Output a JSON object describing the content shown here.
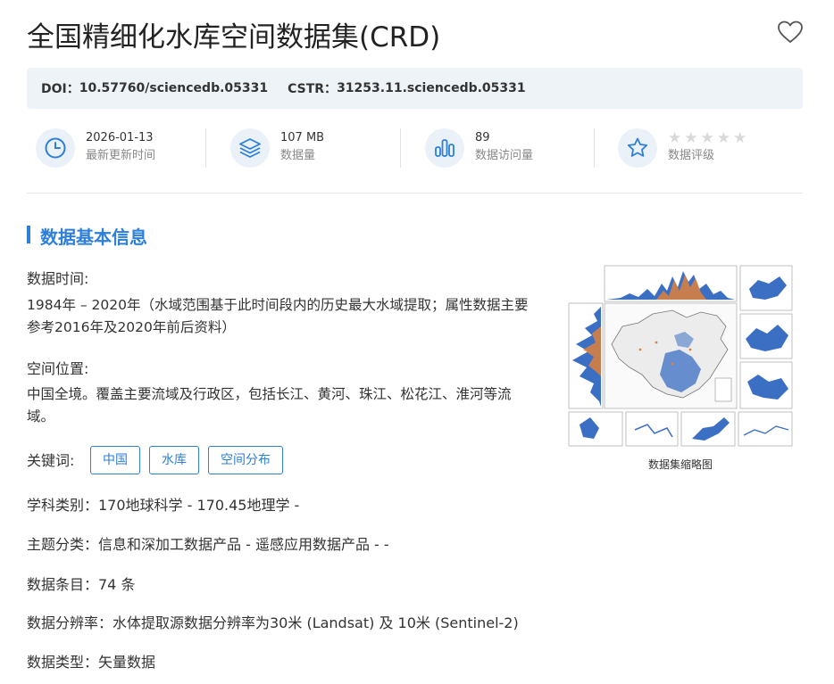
{
  "header": {
    "title": "全国精细化水库空间数据集(CRD)"
  },
  "identifiers": {
    "doi_label": "DOI：",
    "doi_value": "10.57760/sciencedb.05331",
    "cstr_label": "CSTR：",
    "cstr_value": "31253.11.sciencedb.05331"
  },
  "stats": [
    {
      "icon": "clock-icon",
      "value": "2026-01-13",
      "label": "最新更新时间"
    },
    {
      "icon": "layers-icon",
      "value": "107 MB",
      "label": "数据量"
    },
    {
      "icon": "bar-chart-icon",
      "value": "89",
      "label": "数据访问量"
    },
    {
      "icon": "star-icon",
      "label": "数据评级",
      "rating": 0,
      "rating_max": 5
    }
  ],
  "section": {
    "title": "数据基本信息"
  },
  "info": {
    "time_label": "数据时间:",
    "time_value": "1984年 – 2020年（水域范围基于此时间段内的历史最大水域提取；属性数据主要参考2016年及2020年前后资料）",
    "space_label": "空间位置:",
    "space_value": "中国全境。覆盖主要流域及行政区，包括长江、黄河、珠江、松花江、淮河等流域。",
    "keywords_label": "关键词:",
    "keywords": [
      "中国",
      "水库",
      "空间分布"
    ],
    "subject": "学科类别：170地球科学 - 170.45地理学 -",
    "theme": "主题分类：信息和深加工数据产品 - 遥感应用数据产品 - -",
    "entries": "数据条目：74 条",
    "resolution": "数据分辨率：水体提取源数据分辨率为30米 (Landsat) 及 10米 (Sentinel-2)",
    "type": "数据类型：矢量数据"
  },
  "thumbnail": {
    "caption": "数据集缩略图"
  },
  "colors": {
    "accent": "#2d7fd9",
    "id_bar_bg": "#eef3f8",
    "icon_bg": "#eaf1f9",
    "star_empty": "#d9d9d9"
  }
}
